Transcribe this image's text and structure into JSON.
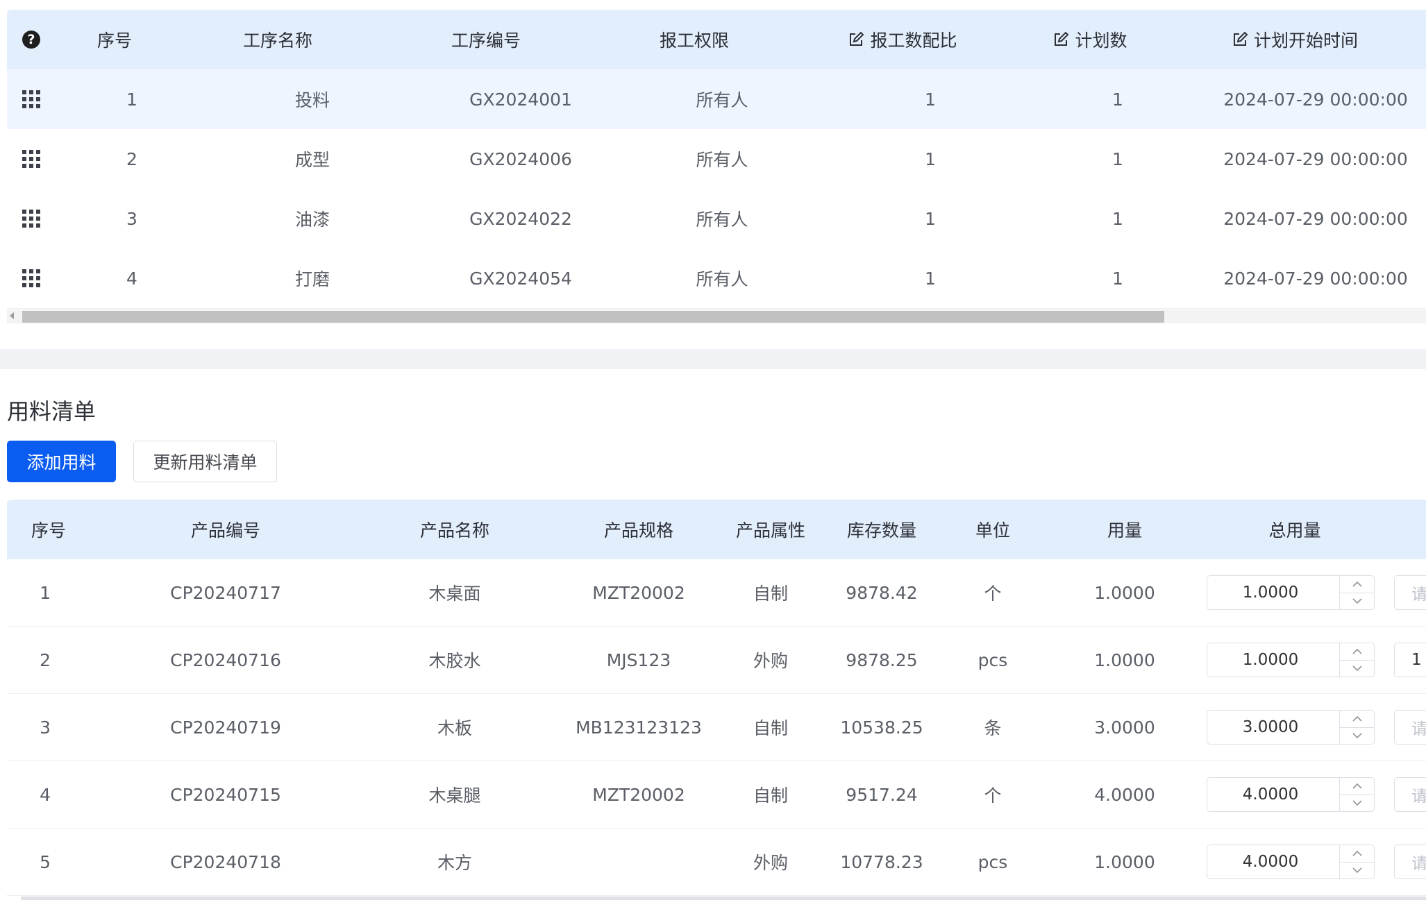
{
  "process_table": {
    "columns": [
      {
        "label": "序号",
        "editable": false
      },
      {
        "label": "工序名称",
        "editable": false
      },
      {
        "label": "工序编号",
        "editable": false
      },
      {
        "label": "报工权限",
        "editable": false
      },
      {
        "label": "报工数配比",
        "editable": true
      },
      {
        "label": "计划数",
        "editable": true
      },
      {
        "label": "计划开始时间",
        "editable": true
      }
    ],
    "help_icon_glyph": "?",
    "rows": [
      {
        "seq": "1",
        "name": "投料",
        "code": "GX2024001",
        "permission": "所有人",
        "ratio": "1",
        "plan": "1",
        "start": "2024-07-29 00:00:00"
      },
      {
        "seq": "2",
        "name": "成型",
        "code": "GX2024006",
        "permission": "所有人",
        "ratio": "1",
        "plan": "1",
        "start": "2024-07-29 00:00:00"
      },
      {
        "seq": "3",
        "name": "油漆",
        "code": "GX2024022",
        "permission": "所有人",
        "ratio": "1",
        "plan": "1",
        "start": "2024-07-29 00:00:00"
      },
      {
        "seq": "4",
        "name": "打磨",
        "code": "GX2024054",
        "permission": "所有人",
        "ratio": "1",
        "plan": "1",
        "start": "2024-07-29 00:00:00"
      }
    ]
  },
  "material_section": {
    "title": "用料清单",
    "add_button": "添加用料",
    "update_button": "更新用料清单",
    "columns": [
      "序号",
      "产品编号",
      "产品名称",
      "产品规格",
      "产品属性",
      "库存数量",
      "单位",
      "用量",
      "总用量"
    ],
    "rows": [
      {
        "seq": "1",
        "code": "CP20240717",
        "name": "木桌面",
        "spec": "MZT20002",
        "attr": "自制",
        "stock": "9878.42",
        "unit": "个",
        "usage": "1.0000",
        "total": "1.0000",
        "extra": "请",
        "extra_filled": false
      },
      {
        "seq": "2",
        "code": "CP20240716",
        "name": "木胶水",
        "spec": "MJS123",
        "attr": "外购",
        "stock": "9878.25",
        "unit": "pcs",
        "usage": "1.0000",
        "total": "1.0000",
        "extra": "1",
        "extra_filled": true
      },
      {
        "seq": "3",
        "code": "CP20240719",
        "name": "木板",
        "spec": "MB123123123",
        "attr": "自制",
        "stock": "10538.25",
        "unit": "条",
        "usage": "3.0000",
        "total": "3.0000",
        "extra": "请",
        "extra_filled": false
      },
      {
        "seq": "4",
        "code": "CP20240715",
        "name": "木桌腿",
        "spec": "MZT20002",
        "attr": "自制",
        "stock": "9517.24",
        "unit": "个",
        "usage": "4.0000",
        "total": "4.0000",
        "extra": "请",
        "extra_filled": false
      },
      {
        "seq": "5",
        "code": "CP20240718",
        "name": "木方",
        "spec": "",
        "attr": "外购",
        "stock": "10778.23",
        "unit": "pcs",
        "usage": "1.0000",
        "total": "4.0000",
        "extra": "请",
        "extra_filled": false
      }
    ]
  },
  "colors": {
    "header_bg": "#e3eefd",
    "highlight_row": "#eef5fe",
    "primary": "#0b5cf0"
  }
}
